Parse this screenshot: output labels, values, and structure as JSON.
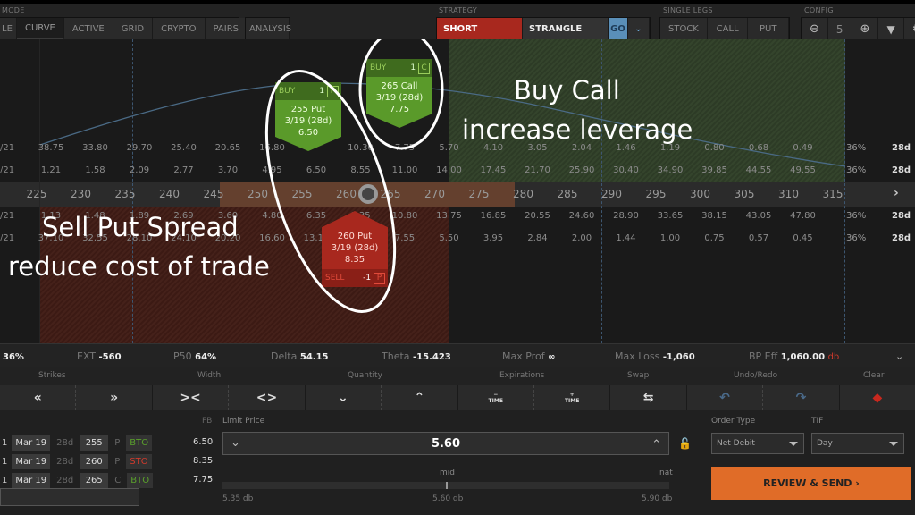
{
  "topbar": {
    "mode_label": "MODE",
    "mode_tabs": [
      {
        "label": "LE",
        "active": false
      },
      {
        "label": "CURVE",
        "active": true
      },
      {
        "label": "ACTIVE",
        "active": false
      },
      {
        "label": "GRID",
        "active": false
      },
      {
        "label": "CRYPTO",
        "active": false
      },
      {
        "label": "PAIRS",
        "active": false
      }
    ],
    "analysis_label": "ANALYSIS",
    "strategy_label": "STRATEGY",
    "strategy_side": "SHORT",
    "strategy_type": "STRANGLE",
    "go_label": "GO",
    "single_legs_label": "SINGLE LEGS",
    "single_legs": [
      "STOCK",
      "CALL",
      "PUT"
    ],
    "config_label": "CONFIG",
    "config_strikes": "5"
  },
  "grid": {
    "row_labels": [
      "/21",
      "/21",
      "",
      "/21",
      "/21"
    ],
    "call_prices_row": [
      "38.75",
      "33.80",
      "29.70",
      "25.40",
      "20.65",
      "16.80",
      "",
      "10.30",
      "7.75",
      "5.70",
      "4.10",
      "3.05",
      "2.04",
      "1.46",
      "1.19",
      "0.80",
      "0.68",
      "0.49"
    ],
    "call_prices_row2": [
      "1.21",
      "1.58",
      "2.09",
      "2.77",
      "3.70",
      "4.95",
      "6.50",
      "8.55",
      "11.00",
      "14.00",
      "17.45",
      "21.70",
      "25.90",
      "30.40",
      "34.90",
      "39.85",
      "44.55",
      "49.55"
    ],
    "strikes": [
      "225",
      "230",
      "235",
      "240",
      "245",
      "250",
      "255",
      "260",
      "265",
      "270",
      "275",
      "280",
      "285",
      "290",
      "295",
      "300",
      "305",
      "310",
      "315"
    ],
    "put_prices_row": [
      "1.13",
      "1.48",
      "1.89",
      "2.69",
      "3.60",
      "4.80",
      "6.35",
      "8.35",
      "10.80",
      "13.75",
      "16.85",
      "20.55",
      "24.60",
      "28.90",
      "33.65",
      "38.15",
      "43.05",
      "47.80"
    ],
    "put_prices_row2": [
      "37.10",
      "32.55",
      "28.10",
      "24.10",
      "20.20",
      "16.60",
      "13.10",
      "",
      "7.55",
      "5.50",
      "3.95",
      "2.84",
      "2.00",
      "1.44",
      "1.00",
      "0.75",
      "0.57",
      "0.45"
    ],
    "iv": [
      "36%",
      "36%",
      "36%",
      "36%"
    ],
    "dte": [
      "28d",
      "28d",
      "28d",
      "28d"
    ]
  },
  "legs_cards": [
    {
      "side": "BUY",
      "qty": "1",
      "type_letter": "P",
      "title": "255 Put",
      "expiry": "3/19 (28d)",
      "price": "6.50",
      "color": "green"
    },
    {
      "side": "BUY",
      "qty": "1",
      "type_letter": "C",
      "title": "265 Call",
      "expiry": "3/19 (28d)",
      "price": "7.75",
      "color": "green"
    },
    {
      "side": "SELL",
      "qty": "-1",
      "type_letter": "P",
      "title": "260 Put",
      "expiry": "3/19 (28d)",
      "price": "8.35",
      "color": "red"
    }
  ],
  "annotations": {
    "buy_call_line1": "Buy Call",
    "buy_call_line2": "increase leverage",
    "sell_put_line1": "Sell Put Spread",
    "sell_put_line2": "reduce cost of trade"
  },
  "stats": {
    "iv": "36%",
    "ext_label": "EXT",
    "ext": "-560",
    "p50_label": "P50",
    "p50": "64%",
    "delta_label": "Delta",
    "delta": "54.15",
    "theta_label": "Theta",
    "theta": "-15.423",
    "maxprof_label": "Max Prof",
    "maxprof": "∞",
    "maxloss_label": "Max Loss",
    "maxloss": "-1,060",
    "bpeff_label": "BP Eff",
    "bpeff": "1,060.00",
    "bpeff_suffix": "db"
  },
  "tools": {
    "labels": [
      "Strikes",
      "Width",
      "Quantity",
      "Expirations",
      "Swap",
      "Undo/Redo",
      "Clear"
    ],
    "time_label": "TIME"
  },
  "order": {
    "fb_label": "FB",
    "legs": [
      {
        "qty": "1",
        "exp": "Mar 19",
        "dte": "28d",
        "strike": "255",
        "type": "P",
        "action": "BTO",
        "price": "6.50"
      },
      {
        "qty": "1",
        "exp": "Mar 19",
        "dte": "28d",
        "strike": "260",
        "type": "P",
        "action": "STO",
        "price": "8.35"
      },
      {
        "qty": "1",
        "exp": "Mar 19",
        "dte": "28d",
        "strike": "265",
        "type": "C",
        "action": "BTO",
        "price": "7.75"
      }
    ],
    "limit_label": "Limit Price",
    "limit_price": "5.60",
    "mid_label": "mid",
    "nat_label": "nat",
    "range_low": "5.35 db",
    "range_mid": "5.60 db",
    "range_high": "5.90 db",
    "order_type_label": "Order Type",
    "order_type": "Net Debit",
    "tif_label": "TIF",
    "tif": "Day",
    "review_label": "REVIEW & SEND"
  },
  "colors": {
    "short": "#a8281e",
    "go": "#5a8fb8",
    "review": "#e06c28",
    "bto": "#5aa02c",
    "sto": "#d03a2c"
  }
}
